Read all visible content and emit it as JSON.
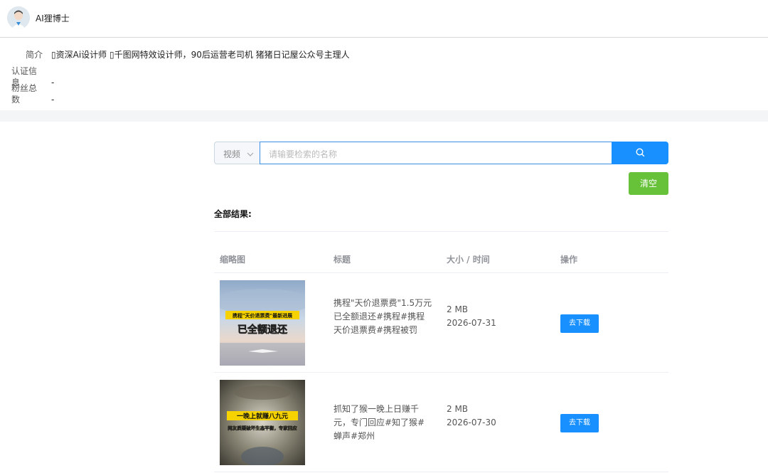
{
  "header": {
    "username": "AI狸博士"
  },
  "profile": {
    "intro_label": "简介",
    "intro_value": "▯资深Ai设计师 ▯千图网特效设计师，90后运营老司机 猪猪日记屋公众号主理人",
    "cert_label": "认证信息",
    "cert_value": "-",
    "fans_label": "粉丝总数",
    "fans_value": "-"
  },
  "search": {
    "type_selected": "视频",
    "placeholder": "请输要检索的名称"
  },
  "clear_label": "清空",
  "results_label": "全部结果:",
  "table": {
    "headers": [
      "缩略图",
      "标题",
      "大小 / 时间",
      "操作"
    ],
    "rows": [
      {
        "thumb_banner": "携程\"天价退票费\"最新进展",
        "thumb_caption": "已全额退还",
        "title": "携程\"天价退票费\"1.5万元已全额退还#携程#携程天价退票费#携程被罚",
        "size": "2 MB",
        "date": "2026-07-31",
        "action": "去下载"
      },
      {
        "thumb_banner": "一晚上就赚八九元",
        "thumb_caption": "网友质疑破坏生态平衡，专家回应",
        "title": "抓知了猴一晚上日赚千元，专门回应#知了猴#蝉声#郑州",
        "size": "2 MB",
        "date": "2026-07-30",
        "action": "去下载"
      }
    ]
  },
  "colors": {
    "primary": "#1890ff",
    "success": "#67c23a",
    "band": "#f4f5f7"
  }
}
